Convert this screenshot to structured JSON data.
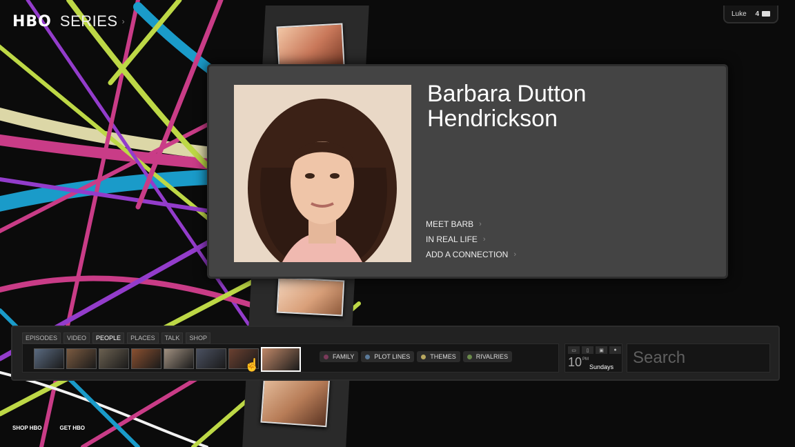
{
  "header": {
    "logo": "HBO",
    "section": "SERIES",
    "section_arrow": "›"
  },
  "user": {
    "name": "Luke",
    "count": "4"
  },
  "person": {
    "name_line1": "Barbara Dutton",
    "name_line2": "Hendrickson",
    "links": [
      {
        "label": "MEET BARB"
      },
      {
        "label": "IN REAL LIFE"
      },
      {
        "label": "ADD A CONNECTION"
      }
    ]
  },
  "nav": {
    "tabs": [
      {
        "label": "EPISODES",
        "active": false
      },
      {
        "label": "VIDEO",
        "active": false
      },
      {
        "label": "PEOPLE",
        "active": true
      },
      {
        "label": "PLACES",
        "active": false
      },
      {
        "label": "TALK",
        "active": false
      },
      {
        "label": "SHOP",
        "active": false
      }
    ],
    "thumbnails": [
      {
        "color": "#5a6a80"
      },
      {
        "color": "#7a5a40"
      },
      {
        "color": "#6a6050"
      },
      {
        "color": "#8a5030"
      },
      {
        "color": "#a09080"
      },
      {
        "color": "#4a5060"
      },
      {
        "color": "#6a4030"
      },
      {
        "color": "#c08868"
      }
    ],
    "selected_thumbnail": 7,
    "filters": [
      {
        "label": "FAMILY",
        "color": "#7a3a5a"
      },
      {
        "label": "PLOT LINES",
        "color": "#5a7a9a"
      },
      {
        "label": "THEMES",
        "color": "#b8a860"
      },
      {
        "label": "RIVALRIES",
        "color": "#6a8a4a"
      }
    ],
    "schedule": {
      "time": "10",
      "meridiem": "PM",
      "day": "Sundays",
      "icons": [
        "tv-icon",
        "mobile-icon",
        "video-icon",
        "mouse-icon"
      ]
    },
    "search_placeholder": "Search"
  },
  "footer": {
    "links": [
      {
        "label": "SHOP HBO"
      },
      {
        "label": "GET HBO"
      }
    ]
  }
}
